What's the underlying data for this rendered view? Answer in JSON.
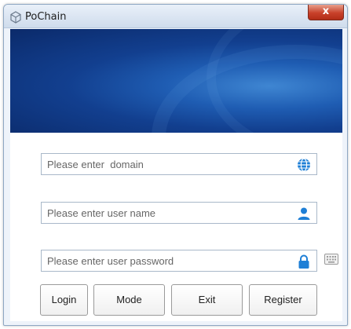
{
  "window": {
    "title": "PoChain",
    "close_glyph": "x"
  },
  "form": {
    "domain": {
      "placeholder": "Please enter  domain",
      "value": "",
      "icon": "globe-icon"
    },
    "username": {
      "placeholder": "Please enter user name",
      "value": "",
      "icon": "user-icon"
    },
    "password": {
      "placeholder": "Please enter user password",
      "value": "",
      "icon": "lock-icon"
    },
    "keyboard_icon": "keyboard-icon"
  },
  "buttons": {
    "login": "Login",
    "mode": "Mode",
    "exit": "Exit",
    "register": "Register"
  },
  "colors": {
    "accent": "#1e7fd6",
    "banner": "#123f8f",
    "close": "#c8412a"
  }
}
